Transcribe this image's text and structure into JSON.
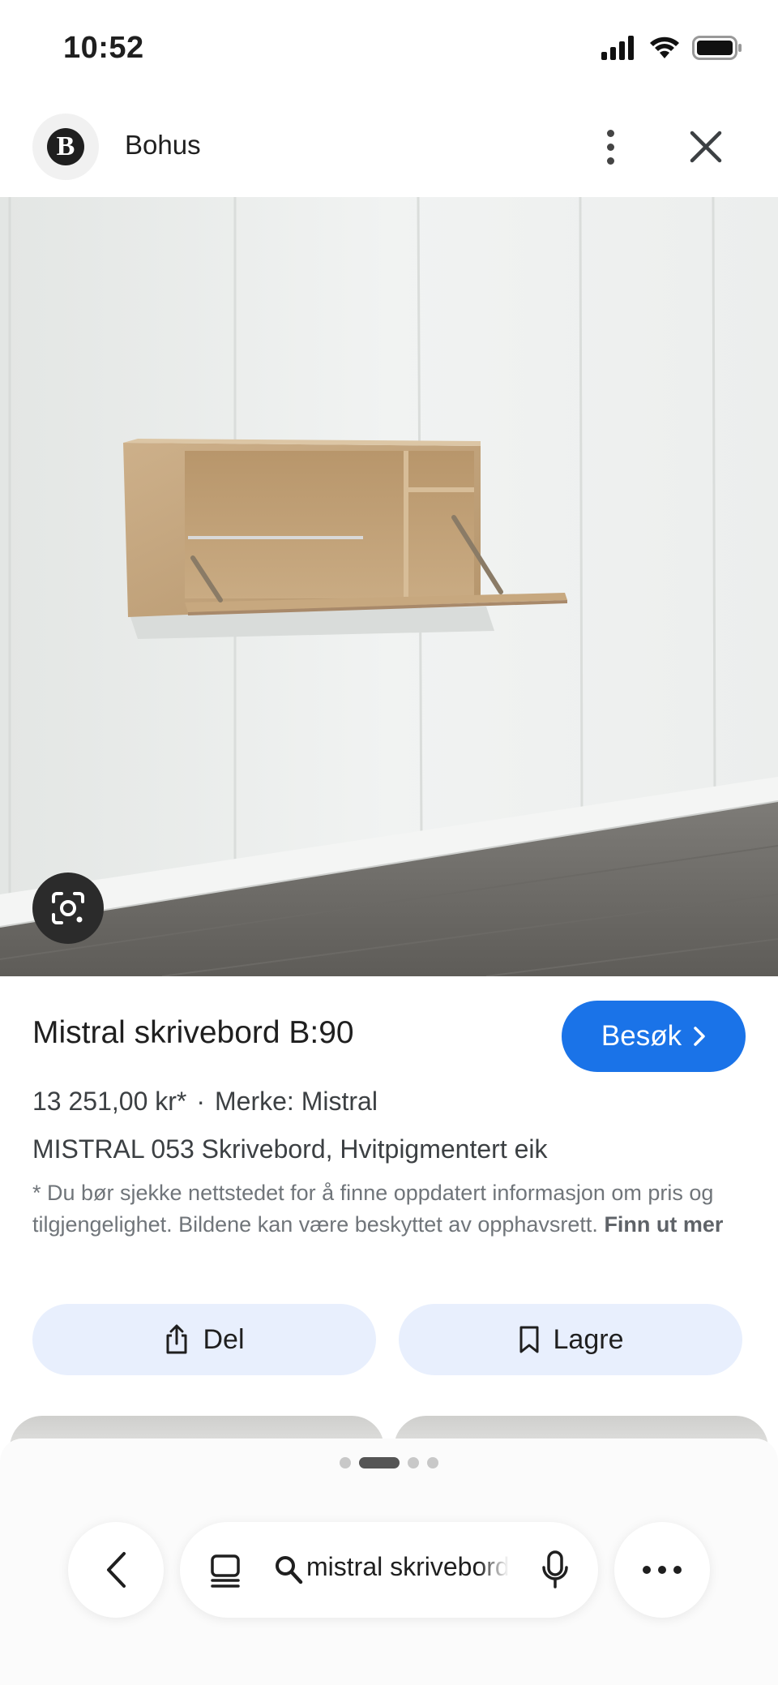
{
  "status_bar": {
    "time": "10:52"
  },
  "header": {
    "site_name": "Bohus",
    "logo_letter": "B"
  },
  "product": {
    "title": "Mistral skrivebord B:90",
    "visit_label": "Besøk",
    "price": "13 251,00 kr*",
    "separator": "·",
    "brand": "Merke: Mistral",
    "description": "MISTRAL 053 Skrivebord, Hvitpigmentert eik",
    "disclaimer": "* Du bør sjekke nettstedet for å finne oppdatert informasjon om pris og tilgjengelighet. Bildene kan være beskyttet av opphavsrett.",
    "disclaimer_link": "Finn ut mer"
  },
  "actions": {
    "share_label": "Del",
    "save_label": "Lagre"
  },
  "pager": {
    "count": 4,
    "active_index": 1
  },
  "bottom_bar": {
    "search_query": "mistral skrivebord"
  },
  "colors": {
    "accent": "#1a73e8",
    "action_bg": "#e8effd"
  }
}
